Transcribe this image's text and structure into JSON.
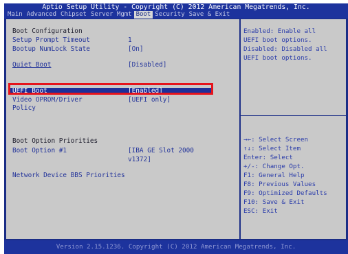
{
  "header": {
    "title": "Aptio Setup Utility - Copyright (C) 2012 American Megatrends, Inc."
  },
  "menu": [
    "Main",
    "Advanced",
    "Chipset",
    "Server Mgmt",
    "Boot",
    "Security",
    "Save & Exit"
  ],
  "menu_active": "Boot",
  "settings": {
    "section_boot_config": "Boot Configuration",
    "setup_prompt_timeout": {
      "label": "Setup Prompt Timeout",
      "value": "1"
    },
    "bootup_numlock": {
      "label": "Bootup NumLock State",
      "value": "[On]"
    },
    "quiet_boot": {
      "label": "Quiet Boot",
      "value": "[Disabled]"
    },
    "uefi_boot": {
      "label": "UEFI Boot",
      "value": "[Enabled]"
    },
    "video_oprom": {
      "label_line1": "Video OPROM/Driver",
      "label_line2": "Policy",
      "value": "[UEFI only]"
    },
    "section_priorities": "Boot Option Priorities",
    "boot_option_1": {
      "label": "Boot Option #1",
      "value_line1": "[IBA GE Slot 2000",
      "value_line2": "v1372]"
    },
    "network_bbs": "Network Device BBS Priorities"
  },
  "help": {
    "lines": [
      "Enabled: Enable all",
      "UEFI boot options.",
      "Disabled: Disabled all",
      "UEFI boot options."
    ],
    "keys": [
      "→←: Select Screen",
      "↑↓: Select Item",
      "Enter: Select",
      "+/-: Change Opt.",
      "F1: General Help",
      "F8: Previous Values",
      "F9: Optimized Defaults",
      "F10: Save & Exit",
      "ESC: Exit"
    ]
  },
  "footer": "Version 2.15.1236. Copyright (C) 2012 American Megatrends, Inc.",
  "colors": {
    "bios_blue": "#1a2d86",
    "panel_gray": "#c9c9c9",
    "highlight_red": "#e5141c"
  }
}
